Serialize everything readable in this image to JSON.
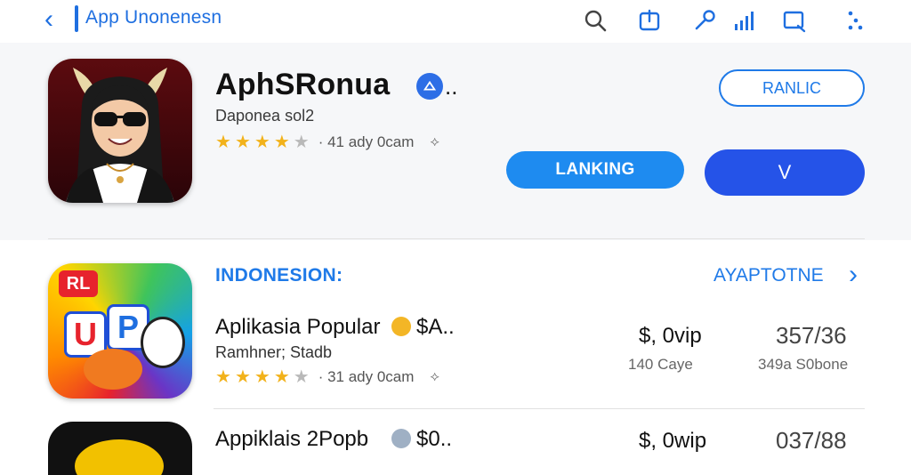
{
  "header": {
    "title": "App Unonenesn",
    "icons": [
      "search-icon",
      "share-icon",
      "key-icon",
      "signal-icon",
      "edit-icon",
      "more-icon"
    ]
  },
  "app": {
    "name": "AphSRonua",
    "name_suffix": "..",
    "developer": "Daponea sol2",
    "rating_stars": 4,
    "rating_meta": "· 41 ady 0cam",
    "outline_button": "RANLIC",
    "primary_button": "LANKING",
    "secondary_button": "V"
  },
  "section": {
    "title": "INDONESION:",
    "action": "AYAPTOTNE"
  },
  "rows": [
    {
      "icon_label": "RL",
      "icon_letters": [
        "U",
        "P"
      ],
      "name": "Aplikasia Popular",
      "badge": "$A..",
      "developer": "Ramhner; Stadb",
      "rating_stars": 4,
      "rating_meta": "· 31 ady 0cam",
      "price": "$, 0vip",
      "price_sub": "140 Caye",
      "stat": "357/36",
      "stat_sub": "349a S0bone"
    },
    {
      "name": "Appiklais 2Popb",
      "badge": "$0..",
      "price": "$, 0wip",
      "stat": "037/88"
    }
  ],
  "colors": {
    "accent": "#1f7ae8",
    "primary_button": "#1e8bf0",
    "secondary_button": "#2553e8",
    "star": "#f2b21b"
  }
}
